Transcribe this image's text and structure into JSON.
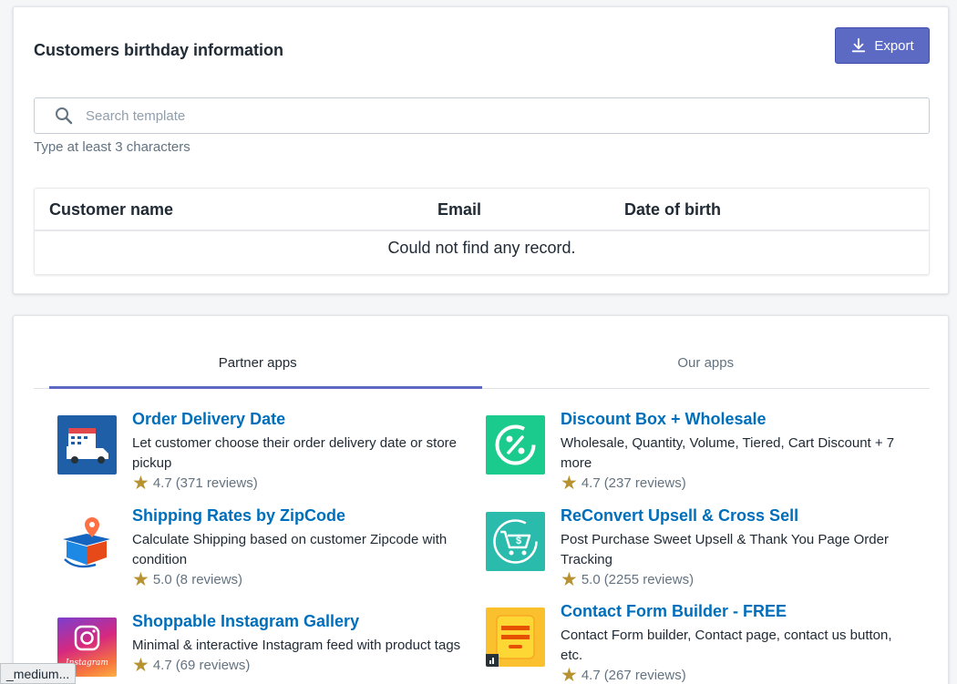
{
  "birthday": {
    "title": "Customers birthday information",
    "export_label": "Export",
    "search_placeholder": "Search template",
    "search_value": "",
    "hint": "Type at least 3 characters",
    "columns": [
      "Customer name",
      "Email",
      "Date of birth"
    ],
    "empty_message": "Could not find any record."
  },
  "apps_section": {
    "tabs": [
      {
        "label": "Partner apps",
        "active": true
      },
      {
        "label": "Our apps",
        "active": false
      }
    ],
    "apps": [
      {
        "name": "Order Delivery Date",
        "description": "Let customer choose their order delivery date or store pickup",
        "rating": "4.7",
        "reviews": "(371 reviews)",
        "icon": "delivery-truck-calendar-icon"
      },
      {
        "name": "Discount Box + Wholesale",
        "description": "Wholesale, Quantity, Volume, Tiered, Cart Discount + 7 more",
        "rating": "4.7",
        "reviews": "(237 reviews)",
        "icon": "percent-icon"
      },
      {
        "name": "Shipping Rates by ZipCode",
        "description": "Calculate Shipping based on customer Zipcode with condition",
        "rating": "5.0",
        "reviews": "(8 reviews)",
        "icon": "shipping-box-pin-icon"
      },
      {
        "name": "ReConvert Upsell & Cross Sell",
        "description": "Post Purchase Sweet Upsell & Thank You Page Order Tracking",
        "rating": "5.0",
        "reviews": "(2255 reviews)",
        "icon": "cart-dollar-icon"
      },
      {
        "name": "Shoppable Instagram Gallery",
        "description": "Minimal & interactive Instagram feed with product tags",
        "rating": "4.7",
        "reviews": "(69 reviews)",
        "icon": "instagram-icon",
        "logo_text": "Instagram"
      },
      {
        "name": "Contact Form Builder - FREE",
        "description": "Contact Form builder, Contact page, contact us button, etc.",
        "rating": "4.7",
        "reviews": "(267 reviews)",
        "icon": "contact-form-icon"
      }
    ]
  },
  "status_bar": {
    "text": "_medium..."
  },
  "colors": {
    "primary": "#5c6ac4",
    "link": "#006fbb",
    "star": "#b7922f"
  }
}
